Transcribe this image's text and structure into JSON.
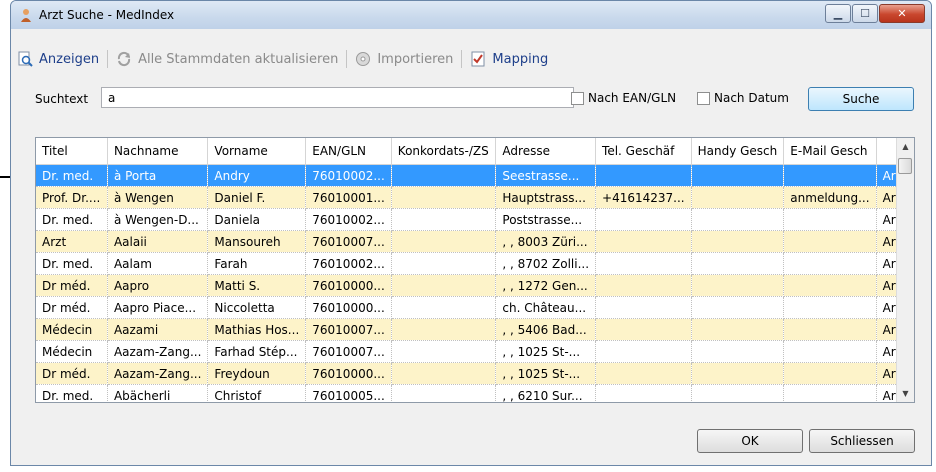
{
  "window": {
    "title": "Arzt Suche - MedIndex",
    "minimize_icon": "minimize-icon",
    "maximize_icon": "maximize-icon",
    "close_icon": "close-icon"
  },
  "toolbar": {
    "items": [
      {
        "label": "Anzeigen",
        "icon": "magnifier-page-icon",
        "enabled": true
      },
      {
        "label": "Alle Stammdaten aktualisieren",
        "icon": "refresh-icon",
        "enabled": false
      },
      {
        "label": "Importieren",
        "icon": "import-disc-icon",
        "enabled": false
      },
      {
        "label": "Mapping",
        "icon": "mapping-checklist-icon",
        "enabled": true
      }
    ]
  },
  "search": {
    "label": "Suchtext",
    "value": "a",
    "chk_ean_label": "Nach EAN/GLN",
    "chk_ean_checked": false,
    "chk_datum_label": "Nach Datum",
    "chk_datum_checked": false,
    "button_label": "Suche"
  },
  "grid": {
    "columns": [
      "Titel",
      "Nachname",
      "Vorname",
      "EAN/GLN",
      "Konkordats-/ZS",
      "Adresse",
      "Tel. Geschäf",
      "Handy Gesch",
      "E-Mail Gesch",
      ""
    ],
    "selected_row": 0,
    "rows": [
      [
        "Dr. med.",
        "à Porta",
        "Andry",
        "76010002...",
        "",
        "Seestrasse...",
        "",
        "",
        "",
        "Arzt"
      ],
      [
        "Prof. Dr....",
        "à Wengen",
        "Daniel F.",
        "76010001...",
        "",
        "Hauptstrass...",
        "+41614237...",
        "",
        "anmeldung...",
        "Arzt"
      ],
      [
        "Dr. med.",
        "à Wengen-D...",
        "Daniela",
        "76010002...",
        "",
        "Poststrasse...",
        "",
        "",
        "",
        "Arzt"
      ],
      [
        "Arzt",
        "Aalaii",
        "Mansoureh",
        "76010007...",
        "",
        ", , 8003 Züri...",
        "",
        "",
        "",
        "Arzt"
      ],
      [
        "Dr. med.",
        "Aalam",
        "Farah",
        "76010002...",
        "",
        ", , 8702 Zolli...",
        "",
        "",
        "",
        "Arzt"
      ],
      [
        "Dr méd.",
        "Aapro",
        "Matti S.",
        "76010000...",
        "",
        ", , 1272 Gen...",
        "",
        "",
        "",
        "Arzt"
      ],
      [
        "Dr méd.",
        "Aapro Piace...",
        "Niccoletta",
        "76010000...",
        "",
        "ch. Château...",
        "",
        "",
        "",
        "Arzt"
      ],
      [
        "Médecin",
        "Aazami",
        "Mathias Hos...",
        "76010007...",
        "",
        ", , 5406 Bad...",
        "",
        "",
        "",
        "Arzt"
      ],
      [
        "Médecin",
        "Aazam-Zang...",
        "Farhad Stép...",
        "76010007...",
        "",
        ", , 1025 St-...",
        "",
        "",
        "",
        "Arzt"
      ],
      [
        "Dr méd.",
        "Aazam-Zang...",
        "Freydoun",
        "76010000...",
        "",
        ", , 1025 St-...",
        "",
        "",
        "",
        "Arzt"
      ],
      [
        "Dr. med.",
        "Abächerli",
        "Christof",
        "76010005...",
        "",
        ", , 6210 Sur...",
        "",
        "",
        "",
        "Arzt"
      ]
    ]
  },
  "footer": {
    "ok_label": "OK",
    "close_label": "Schliessen"
  },
  "pointer_icon": "row-indicator-arrow-icon"
}
